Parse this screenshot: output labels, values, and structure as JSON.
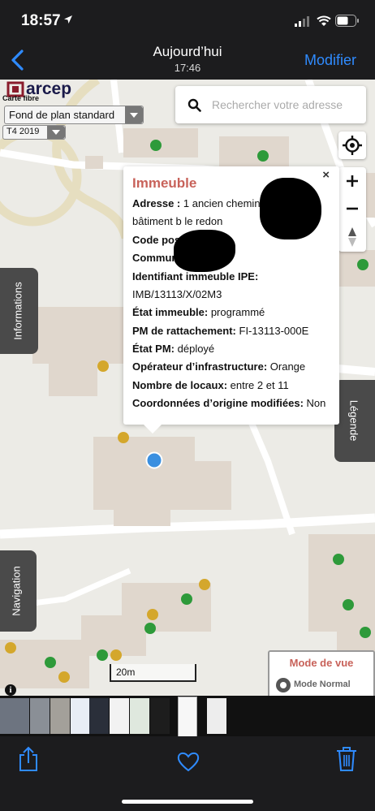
{
  "status_bar": {
    "time": "18:57"
  },
  "nav": {
    "title": "Aujourd’hui",
    "subtitle": "17:46",
    "edit_label": "Modifier"
  },
  "map": {
    "brand": {
      "logo": "arcep",
      "caption": "Carte fibre"
    },
    "layer_select": {
      "value": "Fond de plan standard"
    },
    "period_select": {
      "value": "T4 2019"
    },
    "search_placeholder": "Rechercher votre adresse",
    "tabs": {
      "informations": "Informations",
      "legende": "Légende",
      "navigation": "Navigation"
    },
    "scale_label": "20m",
    "view_mode": {
      "title": "Mode de vue",
      "option": "Mode Normal"
    },
    "popup": {
      "title": "Immeuble",
      "close": "×",
      "address_label": "Adresse :",
      "address_value": "1 ancien chemin",
      "address_line2": "bâtiment b le redon",
      "postal_label": "Code postal:",
      "commune_label": "Commun",
      "ipe_label": "Identifiant immeuble IPE:",
      "ipe_value": "IMB/13113/X/02M3",
      "state_label": "État immeuble:",
      "state_value": "programmé",
      "pm_label": "PM de rattachement:",
      "pm_value": "FI-13113-000E",
      "pm_state_label": "État PM:",
      "pm_state_value": "déployé",
      "operator_label": "Opérateur d’infrastructure:",
      "operator_value": "Orange",
      "units_label": "Nombre de locaux:",
      "units_value": "entre 2 et 11",
      "coords_label": "Coordonnées d’origine modifiées:",
      "coords_value": "Non"
    },
    "colors": {
      "green": "#2e9a3a",
      "yellow": "#d4a72c",
      "location": "#3a8fe0",
      "popup_title": "#c8625a"
    }
  },
  "toolbar": {
    "share_icon": "share-icon",
    "like_icon": "heart-icon",
    "delete_icon": "trash-icon"
  },
  "colors": {
    "accent": "#2f8bff",
    "bar_bg": "#1c1c1e"
  }
}
